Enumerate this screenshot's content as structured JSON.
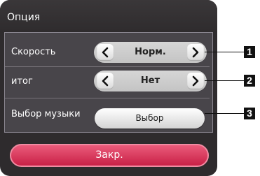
{
  "dialog": {
    "title": "Опция",
    "close_label": "Закр."
  },
  "options": [
    {
      "label": "Скорость",
      "value": "Норм."
    },
    {
      "label": "итог",
      "value": "Нет"
    },
    {
      "label": "Выбор музыки",
      "button_label": "Выбор"
    }
  ],
  "callouts": [
    "1",
    "2",
    "3"
  ],
  "colors": {
    "panel": "#2e2b2d",
    "content": "#48454a",
    "close_button": "#d93358"
  },
  "icons": {
    "prev": "chevron-left-icon",
    "next": "chevron-right-icon"
  }
}
